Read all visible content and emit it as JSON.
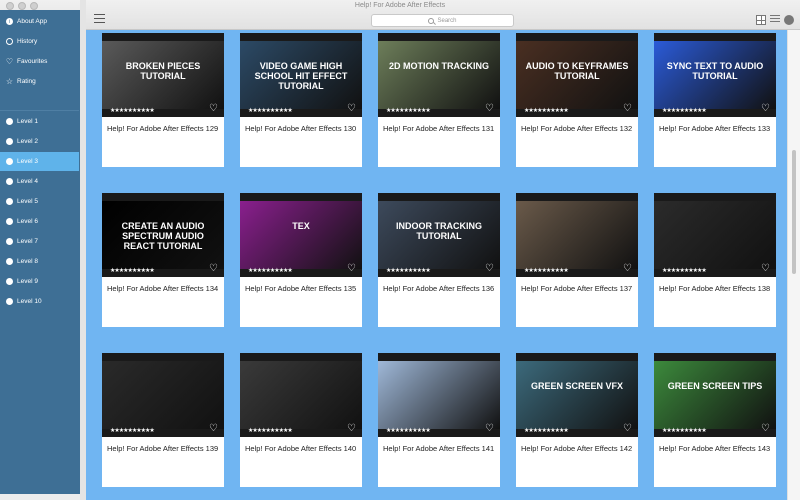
{
  "window": {
    "title": "Help! For Adobe After Effects"
  },
  "toolbar": {
    "search_placeholder": "Search"
  },
  "sidebar": {
    "top_items": [
      {
        "label": "About App",
        "icon": "info-icon"
      },
      {
        "label": "History",
        "icon": "clock-icon"
      },
      {
        "label": "Favourites",
        "icon": "heart-icon"
      },
      {
        "label": "Rating",
        "icon": "star-icon"
      }
    ],
    "levels": [
      {
        "label": "Level 1"
      },
      {
        "label": "Level 2"
      },
      {
        "label": "Level 3"
      },
      {
        "label": "Level 4"
      },
      {
        "label": "Level 5"
      },
      {
        "label": "Level 6"
      },
      {
        "label": "Level 7"
      },
      {
        "label": "Level 8"
      },
      {
        "label": "Level 9"
      },
      {
        "label": "Level 10"
      }
    ],
    "selected": "Level 3"
  },
  "cards": [
    {
      "title": "Help! For Adobe After Effects 129",
      "thumb_text": "BROKEN PIECES TUTORIAL",
      "bg": "#5a5a5a"
    },
    {
      "title": "Help! For Adobe After Effects 130",
      "thumb_text": "VIDEO GAME HIGH SCHOOL HIT EFFECT TUTORIAL",
      "bg": "#2c4a66"
    },
    {
      "title": "Help! For Adobe After Effects 131",
      "thumb_text": "2D MOTION TRACKING",
      "bg": "#6d7e5a"
    },
    {
      "title": "Help! For Adobe After Effects 132",
      "thumb_text": "AUDIO TO KEYFRAMES TUTORIAL",
      "bg": "#4a2f22"
    },
    {
      "title": "Help! For Adobe After Effects 133",
      "thumb_text": "SYNC TEXT TO AUDIO TUTORIAL",
      "bg": "#2b5bd8"
    },
    {
      "title": "Help! For Adobe After Effects 134",
      "thumb_text": "CREATE AN AUDIO SPECTRUM AUDIO REACT TUTORIAL",
      "bg": "#000000"
    },
    {
      "title": "Help! For Adobe After Effects 135",
      "thumb_text": "TEX",
      "bg": "#8a1f8e"
    },
    {
      "title": "Help! For Adobe After Effects 136",
      "thumb_text": "INDOOR TRACKING TUTORIAL",
      "bg": "#3d4a5c"
    },
    {
      "title": "Help! For Adobe After Effects 137",
      "thumb_text": "",
      "bg": "#6a5a4a"
    },
    {
      "title": "Help! For Adobe After Effects 138",
      "thumb_text": "",
      "bg": "#2b2b2b"
    },
    {
      "title": "Help! For Adobe After Effects 139",
      "thumb_text": "",
      "bg": "#2a2a2a"
    },
    {
      "title": "Help! For Adobe After Effects 140",
      "thumb_text": "",
      "bg": "#3a3a3a"
    },
    {
      "title": "Help! For Adobe After Effects 141",
      "thumb_text": "",
      "bg": "#9fb8d8"
    },
    {
      "title": "Help! For Adobe After Effects 142",
      "thumb_text": "GREEN SCREEN VFX",
      "bg": "#3c6a7c"
    },
    {
      "title": "Help! For Adobe After Effects 143",
      "thumb_text": "GREEN SCREEN TIPS",
      "bg": "#3c8a3c"
    }
  ],
  "rating_stars": "★★★★★★★★★★",
  "colors": {
    "sidebar": "#3e6f95",
    "selected": "#5fb3ea",
    "content_bg": "#70b5f2"
  }
}
